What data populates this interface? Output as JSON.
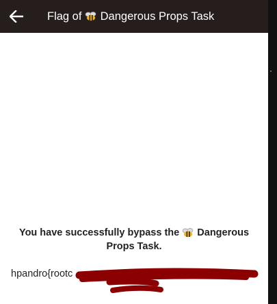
{
  "toolbar": {
    "back_icon": "arrow-left-icon",
    "title_prefix": "Flag of",
    "title_suffix": "Dangerous Props Task"
  },
  "content": {
    "message_prefix": "You have successfully bypass the",
    "message_suffix": "Dangerous Props Task.",
    "flag_visible": "hpandro{rootc",
    "flag_redacted": true
  },
  "colors": {
    "toolbar_bg": "#261d1d",
    "redaction": "#8b0000"
  }
}
